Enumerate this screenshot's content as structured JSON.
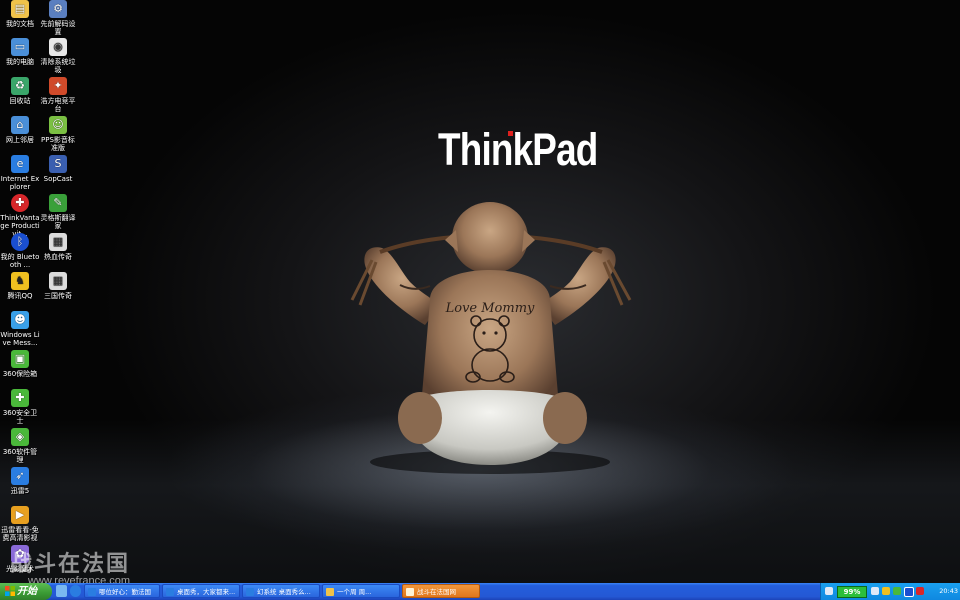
{
  "wallpaper": {
    "brand_text": "ThinkPad",
    "tattoo_text": "Love Mommy",
    "brand_dot_color": "#e0201e"
  },
  "desktop_icons": [
    {
      "label": "我的文档",
      "icon": "my-documents-icon",
      "color": "#f0c24a"
    },
    {
      "label": "先前解码设置",
      "icon": "codec-settings-icon",
      "color": "#5a7fc0"
    },
    {
      "label": "我的电脑",
      "icon": "my-computer-icon",
      "color": "#4a8fd8"
    },
    {
      "label": "清除系统垃圾",
      "icon": "system-cleaner-icon",
      "color": "#e8e8e8"
    },
    {
      "label": "回收站",
      "icon": "recycle-bin-icon",
      "color": "#3aa66a"
    },
    {
      "label": "浩方电竞平台",
      "icon": "haofang-platform-icon",
      "color": "#d04a2a"
    },
    {
      "label": "网上邻居",
      "icon": "network-places-icon",
      "color": "#4a8fd8"
    },
    {
      "label": "PPS影音标准版",
      "icon": "pps-player-icon",
      "color": "#7bc043"
    },
    {
      "label": "Internet Explorer",
      "icon": "internet-explorer-icon",
      "color": "#2a7de1"
    },
    {
      "label": "SopCast",
      "icon": "sopcast-icon",
      "color": "#3a5fb0"
    },
    {
      "label": "ThinkVantage Productivit...",
      "icon": "thinkvantage-icon",
      "color": "#d8262a"
    },
    {
      "label": "灵格斯翻译家",
      "icon": "lingoes-icon",
      "color": "#3aa03a"
    },
    {
      "label": "我的 Bluetooth ...",
      "icon": "bluetooth-icon",
      "color": "#1a4fd0"
    },
    {
      "label": "热血传奇",
      "icon": "game-legend-icon",
      "color": "#dcdcdc"
    },
    {
      "label": "腾讯QQ",
      "icon": "qq-icon",
      "color": "#f0c020"
    },
    {
      "label": "三国传奇",
      "icon": "game-three-kingdoms-icon",
      "color": "#dcdcdc"
    },
    {
      "label": "Windows Live Mess...",
      "icon": "windows-live-messenger-icon",
      "color": "#3aa0e8"
    },
    {
      "label": "360保险箱",
      "icon": "360-safebox-icon",
      "color": "#4ab83a"
    },
    {
      "label": "360安全卫士",
      "icon": "360-security-icon",
      "color": "#4ab83a"
    },
    {
      "label": "360软件管理",
      "icon": "360-software-manager-icon",
      "color": "#4ab83a"
    },
    {
      "label": "迅雷5",
      "icon": "thunder-icon",
      "color": "#2a7de1"
    },
    {
      "label": "迅雷看看-免费高清影视",
      "icon": "xunlei-kankan-icon",
      "color": "#e8a020"
    },
    {
      "label": "光影魔术",
      "icon": "photo-magic-icon",
      "color": "#8a6ad8"
    }
  ],
  "watermark": {
    "title": "战斗在法国",
    "url": "www.revefrance.com"
  },
  "taskbar": {
    "start_label": "开始",
    "quick_launch": [
      {
        "icon": "show-desktop-icon",
        "color": "#7ab8f0"
      },
      {
        "icon": "ie-quick-launch-icon",
        "color": "#2a7de1"
      }
    ],
    "tasks": [
      {
        "label": "哪位好心：勤法国",
        "icon": "ie-window-icon",
        "color": "#2a7de1",
        "active": false
      },
      {
        "label": "桌面秀，大家都来...",
        "icon": "ie-window-icon",
        "color": "#2a7de1",
        "active": false
      },
      {
        "label": "幻系统 桌面秀么...",
        "icon": "ie-window-icon",
        "color": "#2a7de1",
        "active": false
      },
      {
        "label": "一个周 周...",
        "icon": "folder-window-icon",
        "color": "#f0c24a",
        "active": false
      },
      {
        "label": "战斗在法国网",
        "icon": "forum-window-icon",
        "color": "#e0901c",
        "active": true
      }
    ],
    "tray": {
      "battery_percent": "99%",
      "clock": "20:43",
      "icons": [
        "network-tray-icon",
        "volume-tray-icon",
        "qq-tray-icon",
        "360-tray-icon",
        "bluetooth-tray-icon",
        "security-tray-icon"
      ]
    }
  }
}
